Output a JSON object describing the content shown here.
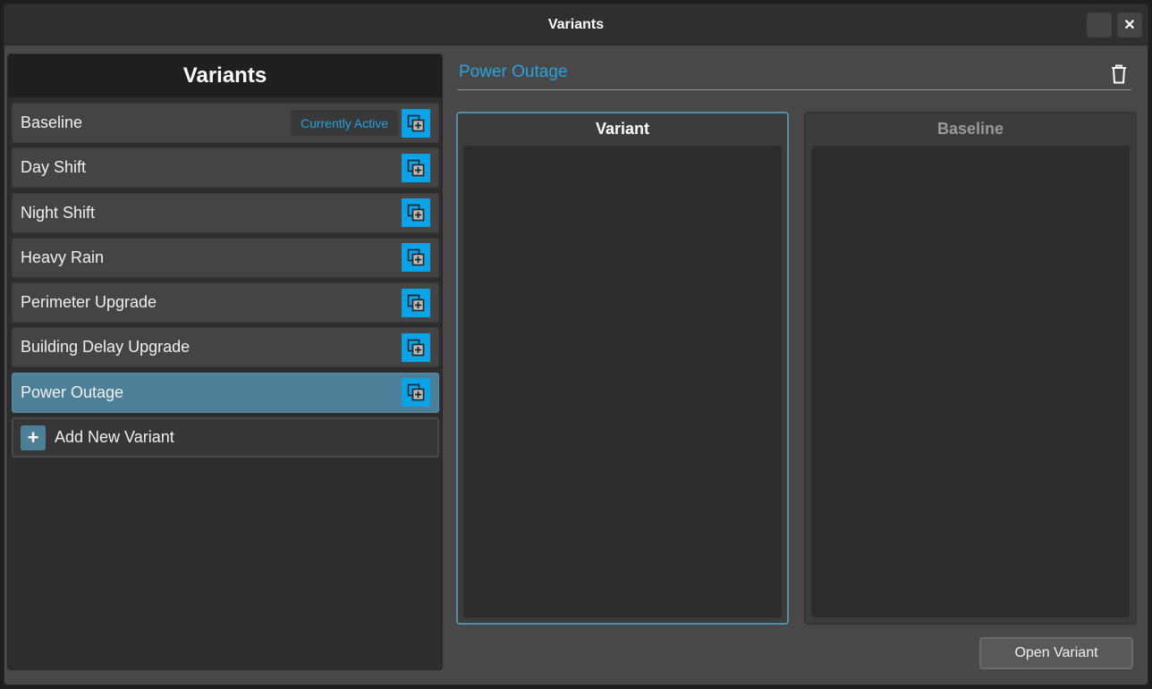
{
  "window": {
    "title": "Variants",
    "close_label": "✕"
  },
  "sidebar": {
    "header": "Variants",
    "active_badge": "Currently Active",
    "items": [
      {
        "label": "Baseline"
      },
      {
        "label": "Day Shift"
      },
      {
        "label": "Night Shift"
      },
      {
        "label": "Heavy Rain"
      },
      {
        "label": "Perimeter Upgrade"
      },
      {
        "label": "Building Delay Upgrade"
      },
      {
        "label": "Power Outage"
      }
    ],
    "selected_index": 6,
    "add_label": "Add New Variant",
    "add_icon_glyph": "+"
  },
  "detail": {
    "title": "Power Outage",
    "variant_header": "Variant",
    "baseline_header": "Baseline",
    "open_button": "Open Variant"
  },
  "colors": {
    "accent": "#29a3e0",
    "copy_button": "#0aa3e8",
    "selected_row": "#4e7f98"
  },
  "icons": {
    "copy": "copy-add-icon",
    "delete": "trash-icon",
    "close": "close-icon",
    "add": "plus-icon"
  }
}
